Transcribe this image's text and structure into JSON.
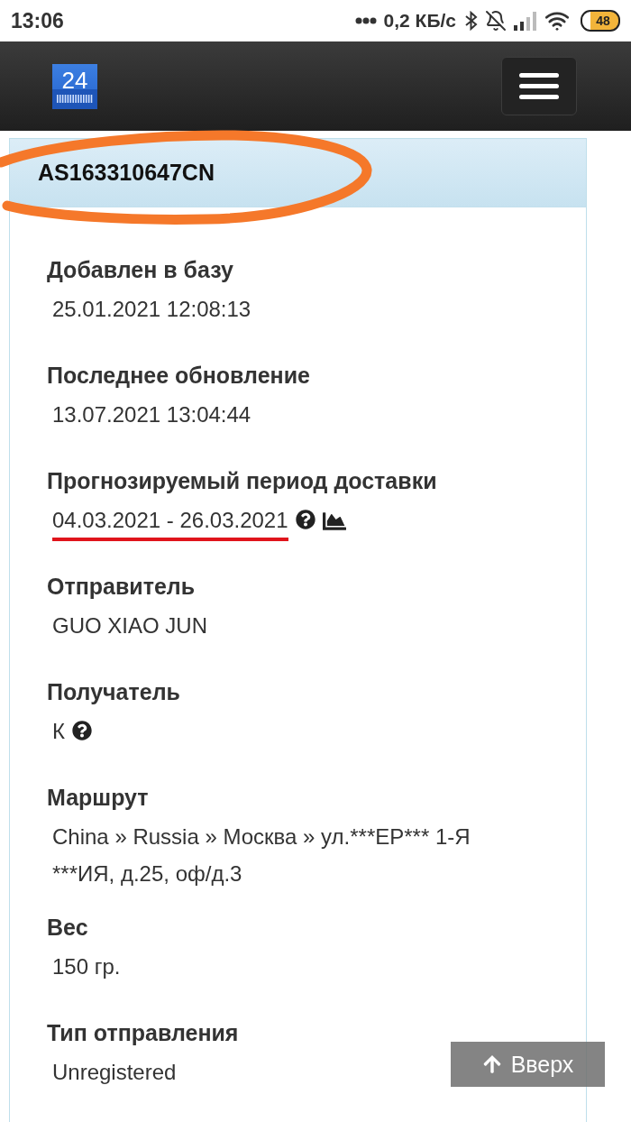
{
  "status_bar": {
    "time": "13:06",
    "network_speed": "0,2 КБ/с",
    "battery": "48"
  },
  "header": {
    "logo_text": "24"
  },
  "parcel": {
    "tracking_number": "AS163310647CN",
    "circled": true
  },
  "fields": [
    {
      "kind": "text",
      "label": "Добавлен в базу",
      "value": "25.01.2021 12:08:13",
      "underlined": false
    },
    {
      "kind": "text",
      "label": "Последнее обновление",
      "value": "13.07.2021 13:04:44",
      "underlined": false
    },
    {
      "kind": "forecast",
      "label": "Прогнозируемый период доставки",
      "value": "04.03.2021 - 26.03.2021",
      "underlined": true
    },
    {
      "kind": "text",
      "label": "Отправитель",
      "value": "GUO XIAO JUN",
      "underlined": false
    },
    {
      "kind": "help",
      "label": "Получатель",
      "value": "К",
      "underlined": false
    },
    {
      "kind": "text",
      "label": "Маршрут",
      "value": "China » Russia » Москва » ул.***ЕР*** 1-Я ***ИЯ, д.25, оф/д.3",
      "underlined": false
    },
    {
      "kind": "text",
      "label": "Вес",
      "value": "150 гр.",
      "underlined": false
    },
    {
      "kind": "text",
      "label": "Тип отправления",
      "value": "Unregistered",
      "underlined": false
    }
  ],
  "scroll_top_button": {
    "label": "Вверх"
  }
}
